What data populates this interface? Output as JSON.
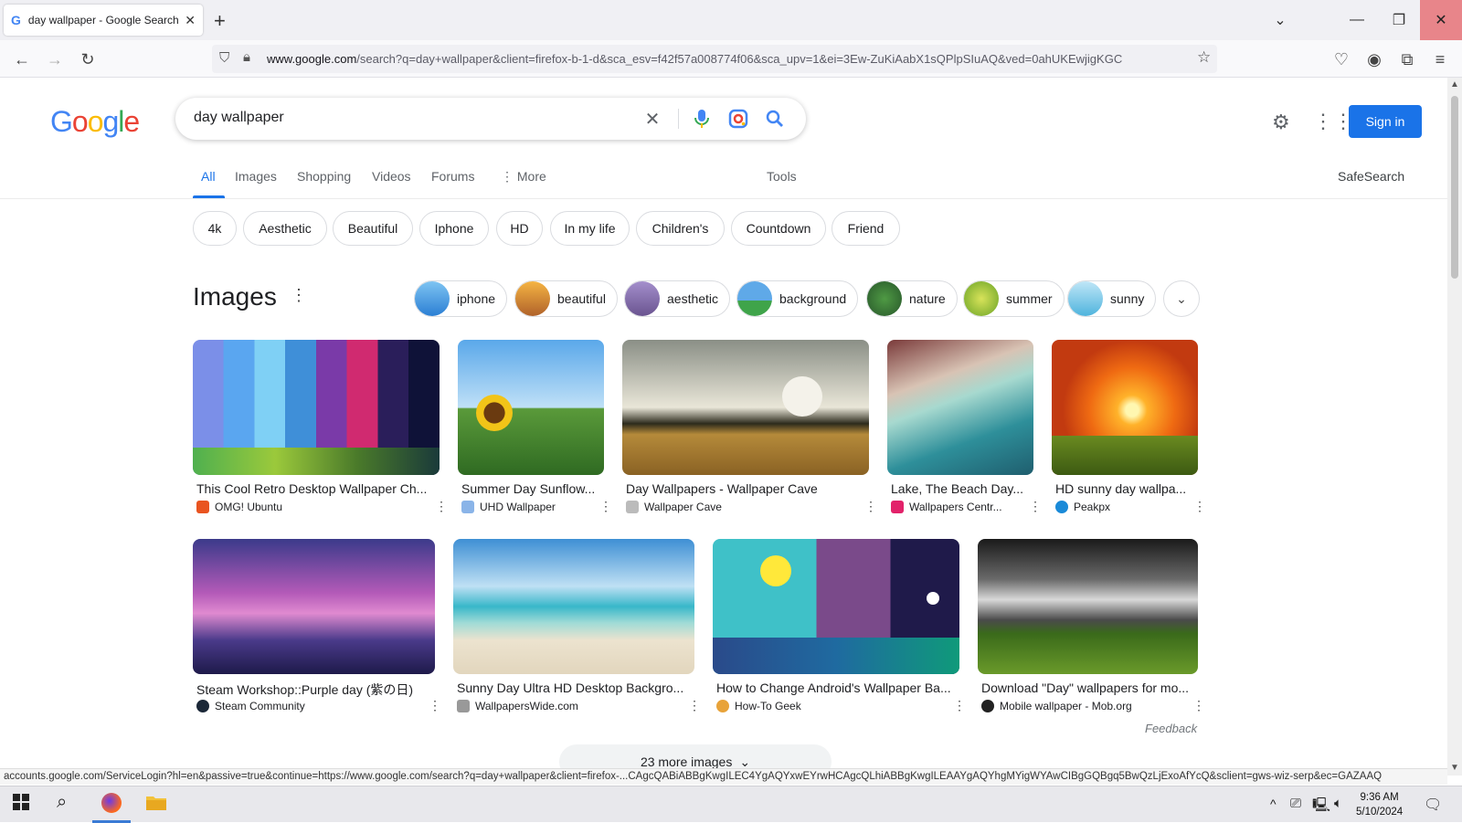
{
  "browser": {
    "tab_title": "day wallpaper - Google Search",
    "tab_favicon": "G",
    "url_domain": "www.google.com",
    "url_rest": "/search?q=day+wallpaper&client=firefox-b-1-d&sca_esv=f42f57a008774f06&sca_upv=1&ei=3Ew-ZuKiAabX1sQPlpSIuAQ&ved=0ahUKEwjigKGC",
    "status_url": "accounts.google.com/ServiceLogin?hl=en&passive=true&continue=https://www.google.com/search?q=day+wallpaper&client=firefox-...CAgcQABiABBgKwgILEC4YgAQYxwEYrwHCAgcQLhiABBgKwgILEAAYgAQYhgMYigWYAwCIBgGQBgq5BwQzLjExoAfYcQ&sclient=gws-wiz-serp&ec=GAZAAQ"
  },
  "google": {
    "logo": "Google",
    "query": "day wallpaper",
    "sign_in": "Sign in",
    "safesearch": "SafeSearch",
    "tools": "Tools",
    "tabs": [
      "All",
      "Images",
      "Shopping",
      "Videos",
      "Forums",
      "More"
    ],
    "chips": [
      "4k",
      "Aesthetic",
      "Beautiful",
      "Iphone",
      "HD",
      "In my life",
      "Children's",
      "Countdown",
      "Friend"
    ],
    "images_title": "Images",
    "image_chips": [
      "iphone",
      "beautiful",
      "aesthetic",
      "background",
      "nature",
      "summer",
      "sunny"
    ],
    "results": [
      {
        "title": "This Cool Retro Desktop Wallpaper Ch...",
        "source": "OMG! Ubuntu"
      },
      {
        "title": "Summer Day Sunflow...",
        "source": "UHD Wallpaper"
      },
      {
        "title": "Day Wallpapers - Wallpaper Cave",
        "source": "Wallpaper Cave"
      },
      {
        "title": "Lake, The Beach Day...",
        "source": "Wallpapers Centr..."
      },
      {
        "title": "HD sunny day wallpa...",
        "source": "Peakpx"
      },
      {
        "title": "Steam Workshop::Purple day (紫の日)",
        "source": "Steam Community"
      },
      {
        "title": "Sunny Day Ultra HD Desktop Backgro...",
        "source": "WallpapersWide.com"
      },
      {
        "title": "How to Change Android's Wallpaper Ba...",
        "source": "How-To Geek"
      },
      {
        "title": "Download \"Day\" wallpapers for mo...",
        "source": "Mobile wallpaper - Mob.org"
      }
    ],
    "feedback": "Feedback",
    "more_images": "23 more images"
  },
  "taskbar": {
    "time": "9:36 AM",
    "date": "5/10/2024"
  }
}
